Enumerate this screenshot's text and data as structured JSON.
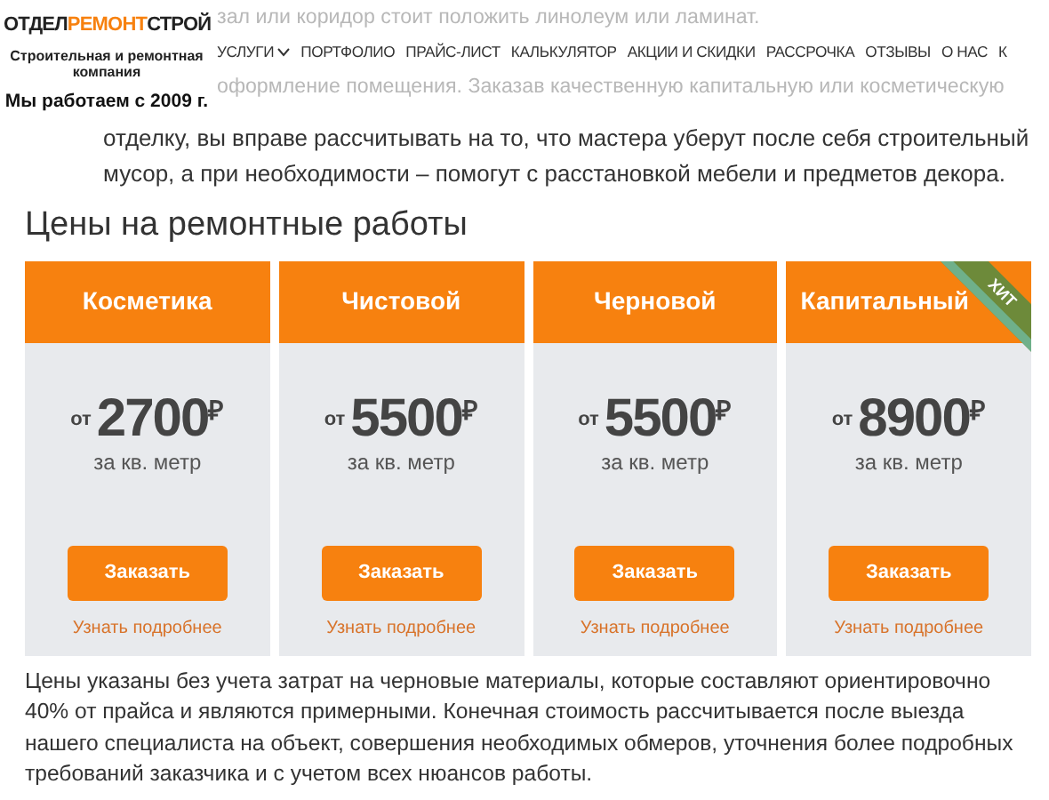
{
  "background_text": [
    "зал или коридор стоит положить линолеум или ламинат.",
    "оформление помещения. Заказав качественную капитальную или косметическую"
  ],
  "intro": "отделку, вы вправе рассчитывать на то, что мастера уберут после себя строительный мусор, а при необходимости – помогут с расстановкой мебели и предметов декора.",
  "header": {
    "logo": [
      {
        "text": "ОТДЕЛ",
        "accent": false
      },
      {
        "text": "РЕМОНТ",
        "accent": true
      },
      {
        "text": "СТРОЙ",
        "accent": false
      }
    ],
    "tagline": "Строительная и ремонтная компания",
    "since": "Мы работаем с 2009 г."
  },
  "nav": [
    {
      "label": "УСЛУГИ",
      "dropdown": true
    },
    {
      "label": "ПОРТФОЛИО",
      "dropdown": false
    },
    {
      "label": "ПРАЙС-ЛИСТ",
      "dropdown": false
    },
    {
      "label": "КАЛЬКУЛЯТОР",
      "dropdown": false
    },
    {
      "label": "АКЦИИ И СКИДКИ",
      "dropdown": false
    },
    {
      "label": "РАССРОЧКА",
      "dropdown": false
    },
    {
      "label": "ОТЗЫВЫ",
      "dropdown": false
    },
    {
      "label": "О НАС",
      "dropdown": false
    },
    {
      "label": "К",
      "dropdown": false
    }
  ],
  "section_title": "Цены на ремонтные работы",
  "plans": [
    {
      "name": "Косметика",
      "prefix": "от",
      "price": "2700",
      "currency": "₽",
      "unit": "за кв. метр",
      "button": "Заказать",
      "link": "Узнать подробнее"
    },
    {
      "name": "Чистовой",
      "prefix": "от",
      "price": "5500",
      "currency": "₽",
      "unit": "за кв. метр",
      "button": "Заказать",
      "link": "Узнать подробнее"
    },
    {
      "name": "Черновой",
      "prefix": "от",
      "price": "5500",
      "currency": "₽",
      "unit": "за кв. метр",
      "button": "Заказать",
      "link": "Узнать подробнее"
    },
    {
      "name": "Капитальный",
      "prefix": "от",
      "price": "8900",
      "currency": "₽",
      "unit": "за кв. метр",
      "button": "Заказать",
      "link": "Узнать подробнее",
      "ribbon": "ХИТ"
    }
  ],
  "note": "Цены указаны без учета затрат на черновые материалы, которые составляют ориентировочно 40% от прайса и являются примерными. Конечная стоимость рассчитывается после выезда нашего специалиста на объект, совершения необходимых обмеров, уточнения более подробных требований заказчика и с учетом всех нюансов работы."
}
